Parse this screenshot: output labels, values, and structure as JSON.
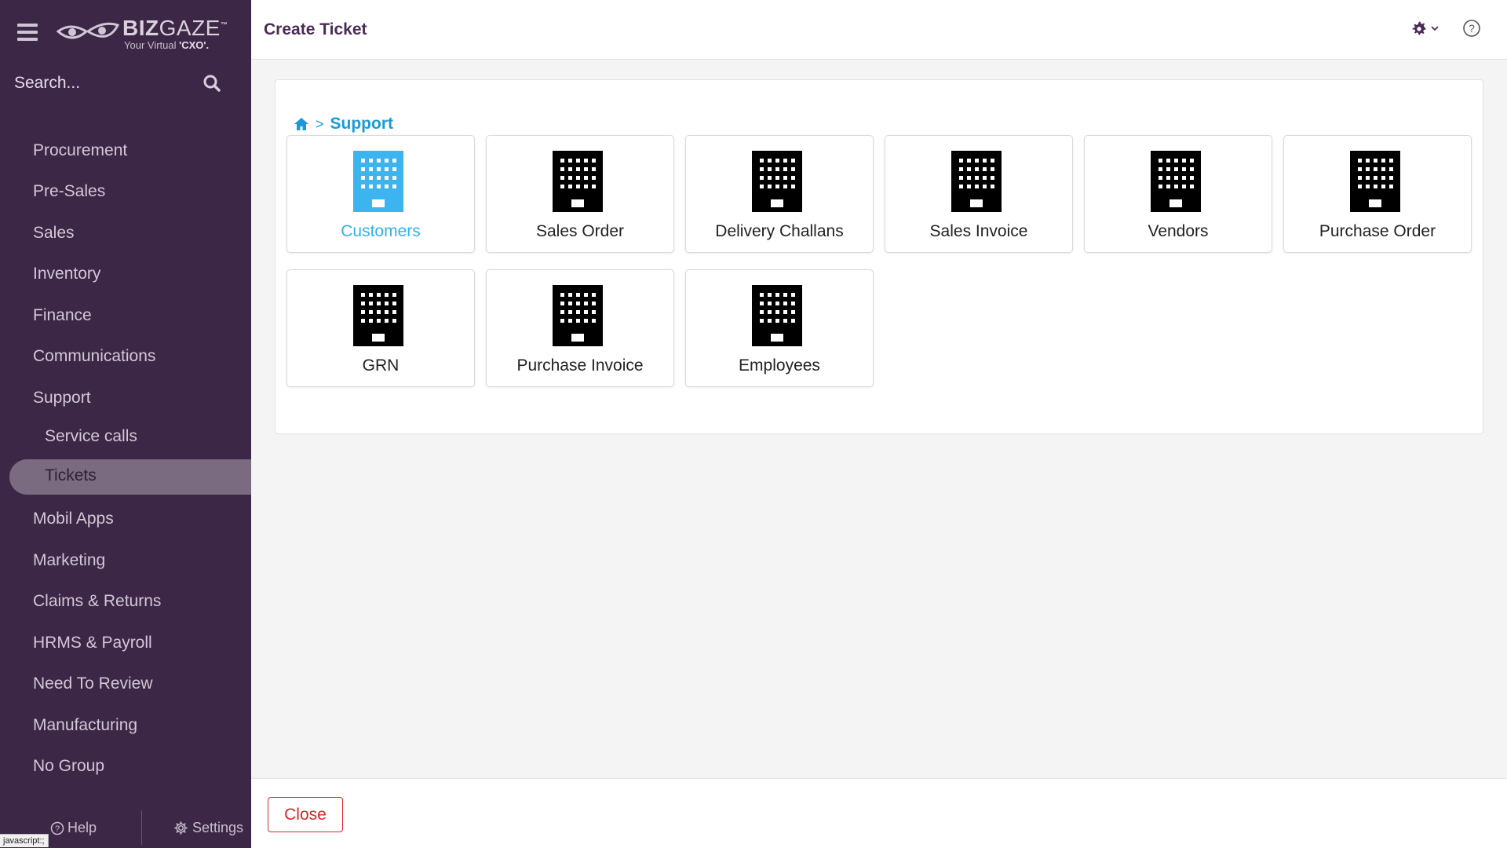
{
  "app": {
    "logo_biz": "BIZ",
    "logo_gaze": "GAZE",
    "logo_tm": "™",
    "tagline_prefix": "Your Virtual ",
    "tagline_bold": "'CXO'."
  },
  "search": {
    "placeholder": "Search..."
  },
  "sidebar": {
    "items": [
      {
        "label": "Procurement"
      },
      {
        "label": "Pre-Sales"
      },
      {
        "label": "Sales"
      },
      {
        "label": "Inventory"
      },
      {
        "label": "Finance"
      },
      {
        "label": "Communications"
      },
      {
        "label": "Support"
      },
      {
        "label": "Service calls"
      },
      {
        "label": "Tickets"
      },
      {
        "label": "Mobil Apps"
      },
      {
        "label": "Marketing"
      },
      {
        "label": "Claims & Returns"
      },
      {
        "label": "HRMS & Payroll"
      },
      {
        "label": "Need To Review"
      },
      {
        "label": "Manufacturing"
      },
      {
        "label": "No Group"
      }
    ],
    "active": "Tickets",
    "footer": {
      "help": "Help",
      "settings": "Settings"
    }
  },
  "status_bar": {
    "text": "javascript:;"
  },
  "header": {
    "title": "Create Ticket"
  },
  "breadcrumb": {
    "separator": ">",
    "current": "Support"
  },
  "tiles": [
    {
      "label": "Customers",
      "selected": true
    },
    {
      "label": "Sales Order"
    },
    {
      "label": "Delivery Challans"
    },
    {
      "label": "Sales Invoice"
    },
    {
      "label": "Vendors"
    },
    {
      "label": "Purchase Order"
    },
    {
      "label": "GRN"
    },
    {
      "label": "Purchase Invoice"
    },
    {
      "label": "Employees"
    }
  ],
  "footer": {
    "close_label": "Close"
  },
  "colors": {
    "sidebar_bg": "#3d2747",
    "brand_purple": "#4a2b57",
    "accent_blue": "#2fb3ee",
    "close_red": "#e02424"
  }
}
